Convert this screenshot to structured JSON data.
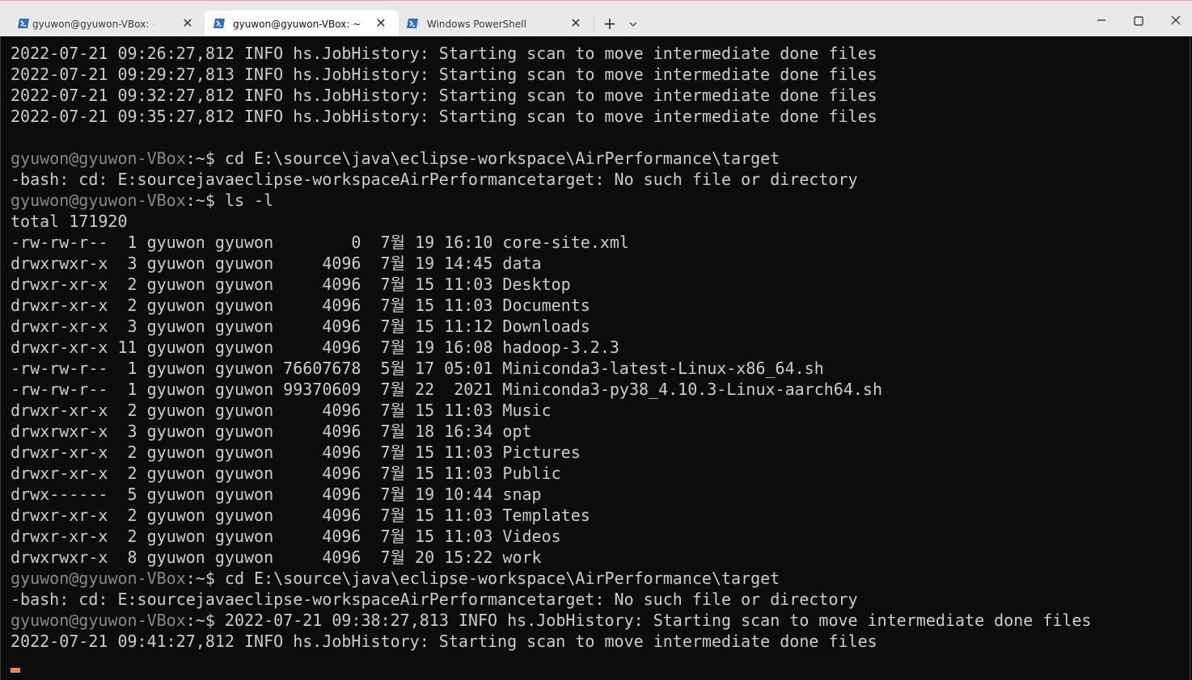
{
  "tabs": [
    {
      "label": "gyuwon@gyuwon-VBox: ~/wc",
      "active": false
    },
    {
      "label": "gyuwon@gyuwon-VBox: ~",
      "active": true
    },
    {
      "label": "Windows PowerShell",
      "active": false
    }
  ],
  "icons": {
    "tab_icon": "terminal-icon",
    "new_tab": "plus-icon",
    "dropdown": "chevron-down-icon",
    "minimize": "minimize-icon",
    "maximize": "maximize-icon",
    "close": "close-icon"
  },
  "symbols": {
    "close": "✕",
    "plus": "+"
  },
  "colors": {
    "terminal_bg": "#0c0c0c",
    "terminal_text": "#cccccc",
    "prompt_user": "#888888",
    "cursor": "#e8875c",
    "tab_icon": "#2f6fc4"
  },
  "terminal": {
    "lines": [
      {
        "text": "2022-07-21 09:26:27,812 INFO hs.JobHistory: Starting scan to move intermediate done files"
      },
      {
        "text": "2022-07-21 09:29:27,813 INFO hs.JobHistory: Starting scan to move intermediate done files"
      },
      {
        "text": "2022-07-21 09:32:27,812 INFO hs.JobHistory: Starting scan to move intermediate done files"
      },
      {
        "text": "2022-07-21 09:35:27,812 INFO hs.JobHistory: Starting scan to move intermediate done files"
      },
      {
        "text": ""
      },
      {
        "prompt": "gyuwon@gyuwon-VBox",
        "path": ":~$ ",
        "text": "cd E:\\source\\java\\eclipse-workspace\\AirPerformance\\target"
      },
      {
        "text": "-bash: cd: E:sourcejavaeclipse-workspaceAirPerformancetarget: No such file or directory"
      },
      {
        "prompt": "gyuwon@gyuwon-VBox",
        "path": ":~$ ",
        "text": "ls -l"
      },
      {
        "text": "total 171920"
      },
      {
        "text": "-rw-rw-r--  1 gyuwon gyuwon        0  7월 19 16:10 core-site.xml"
      },
      {
        "text": "drwxrwxr-x  3 gyuwon gyuwon     4096  7월 19 14:45 data"
      },
      {
        "text": "drwxr-xr-x  2 gyuwon gyuwon     4096  7월 15 11:03 Desktop"
      },
      {
        "text": "drwxr-xr-x  2 gyuwon gyuwon     4096  7월 15 11:03 Documents"
      },
      {
        "text": "drwxr-xr-x  3 gyuwon gyuwon     4096  7월 15 11:12 Downloads"
      },
      {
        "text": "drwxr-xr-x 11 gyuwon gyuwon     4096  7월 19 16:08 hadoop-3.2.3"
      },
      {
        "text": "-rw-rw-r--  1 gyuwon gyuwon 76607678  5월 17 05:01 Miniconda3-latest-Linux-x86_64.sh"
      },
      {
        "text": "-rw-rw-r--  1 gyuwon gyuwon 99370609  7월 22  2021 Miniconda3-py38_4.10.3-Linux-aarch64.sh"
      },
      {
        "text": "drwxr-xr-x  2 gyuwon gyuwon     4096  7월 15 11:03 Music"
      },
      {
        "text": "drwxrwxr-x  3 gyuwon gyuwon     4096  7월 18 16:34 opt"
      },
      {
        "text": "drwxr-xr-x  2 gyuwon gyuwon     4096  7월 15 11:03 Pictures"
      },
      {
        "text": "drwxr-xr-x  2 gyuwon gyuwon     4096  7월 15 11:03 Public"
      },
      {
        "text": "drwx------  5 gyuwon gyuwon     4096  7월 19 10:44 snap"
      },
      {
        "text": "drwxr-xr-x  2 gyuwon gyuwon     4096  7월 15 11:03 Templates"
      },
      {
        "text": "drwxr-xr-x  2 gyuwon gyuwon     4096  7월 15 11:03 Videos"
      },
      {
        "text": "drwxrwxr-x  8 gyuwon gyuwon     4096  7월 20 15:22 work"
      },
      {
        "prompt": "gyuwon@gyuwon-VBox",
        "path": ":~$ ",
        "text": "cd E:\\source\\java\\eclipse-workspace\\AirPerformance\\target"
      },
      {
        "text": "-bash: cd: E:sourcejavaeclipse-workspaceAirPerformancetarget: No such file or directory"
      },
      {
        "prompt": "gyuwon@gyuwon-VBox",
        "path": ":~$ ",
        "text": "2022-07-21 09:38:27,813 INFO hs.JobHistory: Starting scan to move intermediate done files"
      },
      {
        "text": "2022-07-21 09:41:27,812 INFO hs.JobHistory: Starting scan to move intermediate done files"
      }
    ]
  }
}
